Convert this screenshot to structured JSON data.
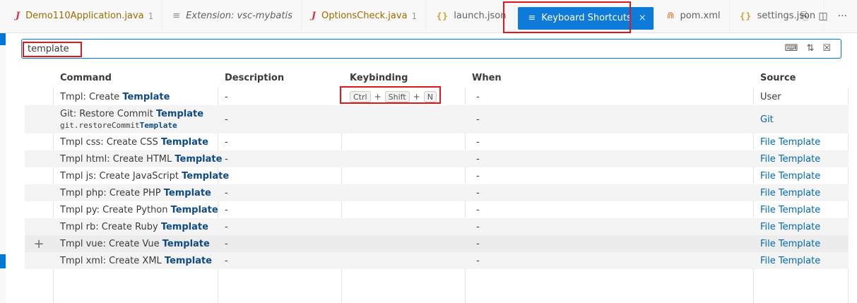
{
  "tabs": [
    {
      "icon": "J",
      "label": "Demo110Application.java",
      "badge": "1",
      "type": "java"
    },
    {
      "icon": "≡",
      "label": "Extension: vsc-mybatis",
      "badge": "",
      "type": "doc"
    },
    {
      "icon": "J",
      "label": "OptionsCheck.java",
      "badge": "1",
      "type": "java"
    },
    {
      "icon": "{}",
      "label": "launch.json",
      "badge": "",
      "type": "json"
    }
  ],
  "active_tab": {
    "icon": "≡",
    "label": "Keyboard Shortcuts",
    "close": "×"
  },
  "tabs_after": [
    {
      "icon": "⋒",
      "label": "pom.xml",
      "type": "rss"
    },
    {
      "icon": "{}",
      "label": "settings.json",
      "type": "json"
    }
  ],
  "tab_actions": {
    "open_changes": "⎘",
    "split": "◫",
    "more": "···"
  },
  "search": {
    "value": "template",
    "icons": {
      "record_keys": "⌨",
      "sort": "⇅",
      "clear": "☒"
    }
  },
  "columns": {
    "command": "Command",
    "description": "Description",
    "keybinding": "Keybinding",
    "when": "When",
    "source": "Source"
  },
  "rows": [
    {
      "prefix": "Tmpl: Create ",
      "match": "Template",
      "id_prefix": "",
      "id_match": "",
      "description": "-",
      "keys": [
        "Ctrl",
        "Shift",
        "N"
      ],
      "when": "-",
      "source": "User",
      "source_link": false
    },
    {
      "prefix": "Git: Restore Commit ",
      "match": "Template",
      "id_prefix": "git.restoreCommit",
      "id_match": "Template",
      "description": "-",
      "keys": [],
      "when": "-",
      "source": "Git",
      "source_link": true
    },
    {
      "prefix": "Tmpl css: Create CSS ",
      "match": "Template",
      "id_prefix": "",
      "id_match": "",
      "description": "-",
      "keys": [],
      "when": "-",
      "source": "File Template",
      "source_link": true
    },
    {
      "prefix": "Tmpl html: Create HTML ",
      "match": "Template",
      "id_prefix": "",
      "id_match": "",
      "description": "-",
      "keys": [],
      "when": "-",
      "source": "File Template",
      "source_link": true
    },
    {
      "prefix": "Tmpl js: Create JavaScript ",
      "match": "Template",
      "id_prefix": "",
      "id_match": "",
      "description": "-",
      "keys": [],
      "when": "-",
      "source": "File Template",
      "source_link": true
    },
    {
      "prefix": "Tmpl php: Create PHP ",
      "match": "Template",
      "id_prefix": "",
      "id_match": "",
      "description": "-",
      "keys": [],
      "when": "-",
      "source": "File Template",
      "source_link": true
    },
    {
      "prefix": "Tmpl py: Create Python ",
      "match": "Template",
      "id_prefix": "",
      "id_match": "",
      "description": "-",
      "keys": [],
      "when": "-",
      "source": "File Template",
      "source_link": true
    },
    {
      "prefix": "Tmpl rb: Create Ruby ",
      "match": "Template",
      "id_prefix": "",
      "id_match": "",
      "description": "-",
      "keys": [],
      "when": "-",
      "source": "File Template",
      "source_link": true
    },
    {
      "prefix": "Tmpl vue: Create Vue ",
      "match": "Template",
      "id_prefix": "",
      "id_match": "",
      "description": "-",
      "keys": [],
      "when": "-",
      "source": "File Template",
      "source_link": true,
      "add": "+"
    },
    {
      "prefix": "Tmpl xml: Create XML ",
      "match": "Template",
      "id_prefix": "",
      "id_match": "",
      "description": "-",
      "keys": [],
      "when": "-",
      "source": "File Template",
      "source_link": true
    }
  ],
  "colors": {
    "accent": "#0078d4",
    "active_tab": "#0e7bd8",
    "highlight_box": "#e0181e",
    "match_text": "#0f4a85",
    "link": "#006ab1"
  }
}
